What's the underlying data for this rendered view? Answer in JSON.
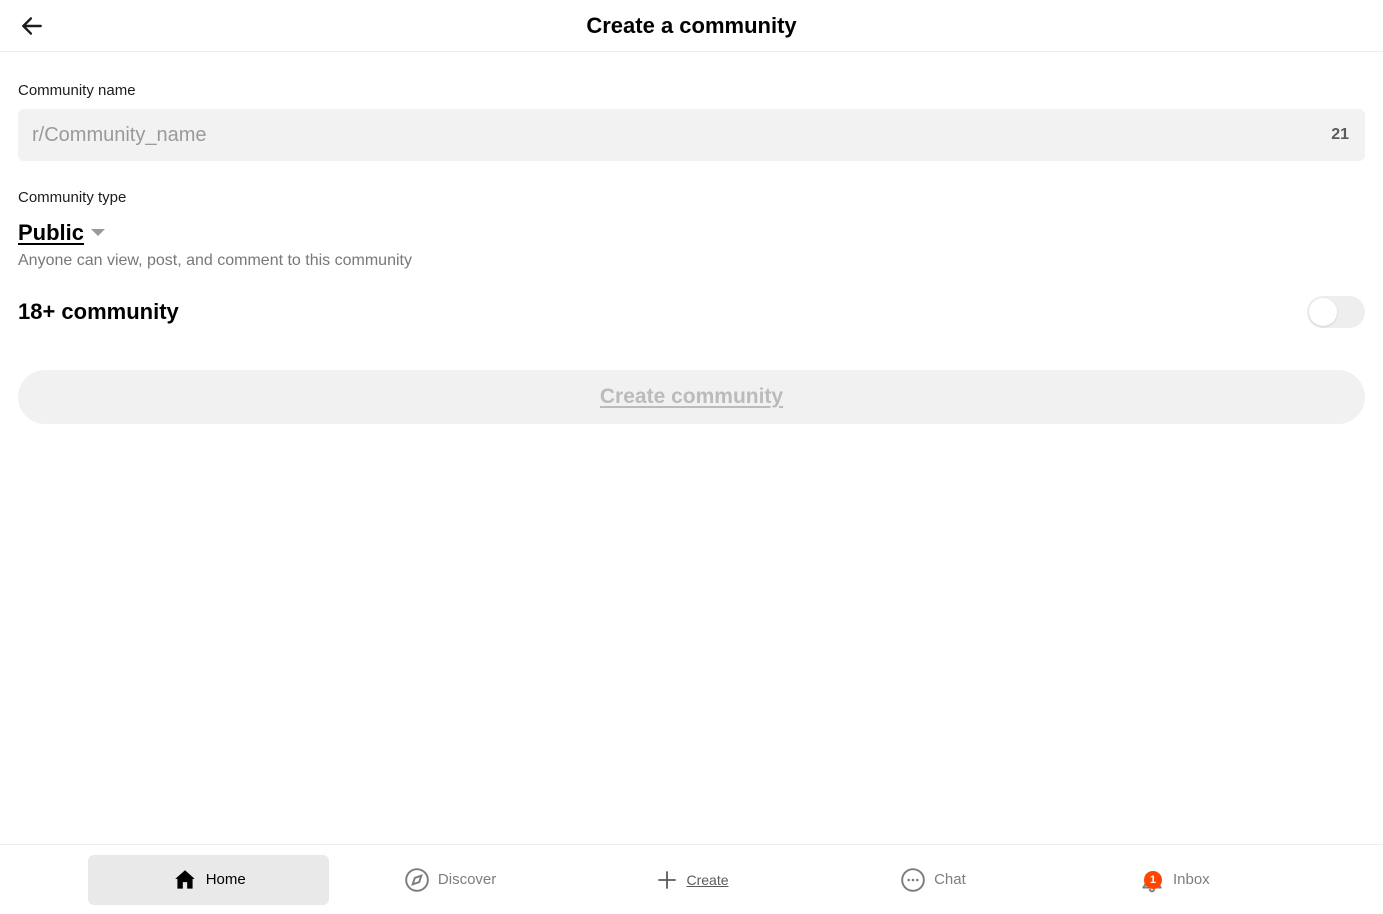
{
  "header": {
    "title": "Create a community"
  },
  "form": {
    "name_label": "Community name",
    "name_placeholder": "r/Community_name",
    "name_value": "",
    "name_counter": "21",
    "type_label": "Community type",
    "type_value": "Public",
    "type_description": "Anyone can view, post, and comment to this community",
    "adult_label": "18+ community",
    "adult_toggle": false,
    "create_button_label": "Create community"
  },
  "nav": {
    "items": [
      {
        "label": "Home",
        "active": true
      },
      {
        "label": "Discover",
        "active": false
      },
      {
        "label": "Create",
        "active": false
      },
      {
        "label": "Chat",
        "active": false
      },
      {
        "label": "Inbox",
        "active": false,
        "badge": "1"
      }
    ]
  }
}
